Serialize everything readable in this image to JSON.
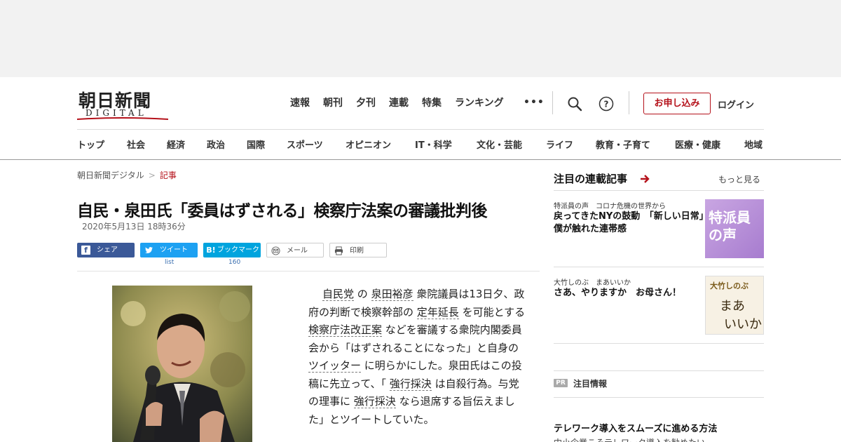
{
  "logo": {
    "title": "朝日新聞",
    "subtitle": "DIGITAL"
  },
  "topnav": [
    "速報",
    "朝刊",
    "夕刊",
    "連載",
    "特集",
    "ランキング"
  ],
  "more_dots": "•••",
  "header": {
    "apply_label": "お申し込み",
    "login_label": "ログイン"
  },
  "categories": [
    "トップ",
    "社会",
    "経済",
    "政治",
    "国際",
    "スポーツ",
    "オピニオン",
    "IT・科学",
    "文化・芸能",
    "ライフ",
    "教育・子育て",
    "医療・健康",
    "地域"
  ],
  "breadcrumb": {
    "home": "朝日新聞デジタル",
    "sep": ">",
    "current": "記事"
  },
  "article": {
    "headline": "自民・泉田氏「委員はずされる」検察庁法案の審議批判後",
    "date": "2020年5月13日 18時36分",
    "body": {
      "p1": "自民党",
      "p2": " の ",
      "p3": "泉田裕彦",
      "p4": " 衆院議員は13日夕、政府の判断で検察幹部の ",
      "p5": "定年延長",
      "p6": " を可能とする ",
      "p7": "検察庁法改正案",
      "p8": " などを審議する衆院内閣委員会から「はずされることになった」と自身の ",
      "p9": "ツイッター",
      "p10": " に明らかにした。泉田氏はこの投稿に先立って、「 ",
      "p11": "強行採決",
      "p12": " は自殺行為。与党の理事に ",
      "p13": "強行採決",
      "p14": " なら退席する旨伝えました」とツイートしていた。"
    }
  },
  "share": {
    "facebook": "シェア",
    "twitter": "ツイート",
    "twitter_count": "list",
    "hatena_icon": "B!",
    "hatena": "ブックマーク",
    "hatena_count": "160",
    "mail": "メール",
    "print": "印刷"
  },
  "sidebar": {
    "title": "注目の連載記事",
    "more": "もっと見る",
    "items": [
      {
        "kicker": "特派員の声　コロナ危機の世界から",
        "headline": "戻ってきたNYの鼓動　「新しい日常」僕が触れた連帯感",
        "thumb_text": "特派員の声"
      },
      {
        "kicker": "大竹しのぶ　まあいいか",
        "headline": "さあ、やりますか　お母さん！",
        "thumb_a": "大竹しのぶ",
        "thumb_b": "まあ",
        "thumb_c": "いいか"
      }
    ],
    "pr_badge": "PR",
    "pr_label": "注目情報",
    "promo_title": "テレワーク導入をスムーズに進める方法",
    "promo_sub": "中小企業こそテレワーク導入を勧めたい"
  },
  "colors": {
    "brand_red": "#b5121b",
    "facebook": "#3b5998",
    "twitter": "#1da1f2",
    "hatena": "#00a4de"
  }
}
